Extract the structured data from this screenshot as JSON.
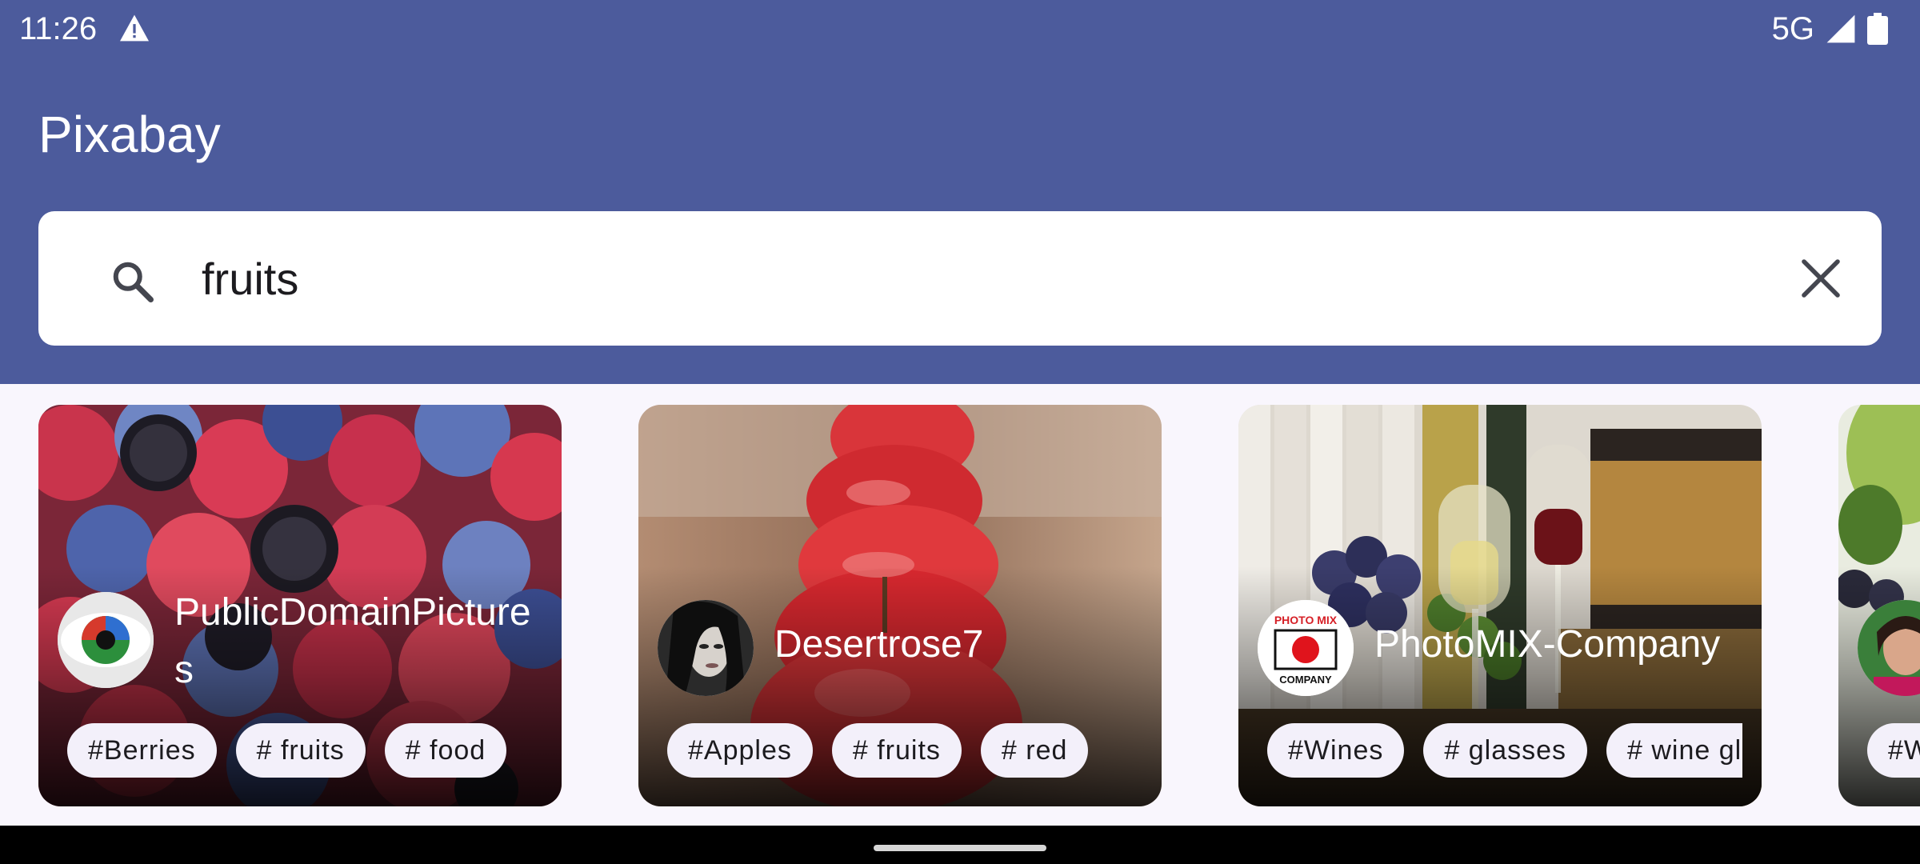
{
  "status_bar": {
    "time": "11:26",
    "network": "5G"
  },
  "app": {
    "title": "Pixabay"
  },
  "search": {
    "query": "fruits"
  },
  "cards": [
    {
      "author": "PublicDomainPictures",
      "tags": [
        "#Berries",
        "# fruits",
        "# food"
      ]
    },
    {
      "author": "Desertrose7",
      "tags": [
        "#Apples",
        "# fruits",
        "# red"
      ]
    },
    {
      "author": "PhotoMIX-Company",
      "avatar_logo_text": [
        "PHOTO MIX",
        "COMPANY"
      ],
      "tags": [
        "#Wines",
        "# glasses",
        "# wine glasses"
      ]
    },
    {
      "author": "",
      "tags": [
        "#W"
      ]
    }
  ],
  "colors": {
    "app_bar": "#4c5b9c",
    "background": "#f9f6fd",
    "tag_chip": "#f3f0fa"
  },
  "icons": [
    "warning-icon",
    "signal-icon",
    "battery-icon",
    "search-icon",
    "close-icon"
  ]
}
